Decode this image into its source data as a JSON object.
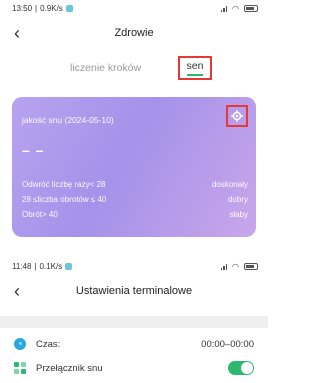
{
  "screen1": {
    "status": {
      "time": "13:50",
      "speed": "0.9K/s"
    },
    "title": "Zdrowie",
    "tabs": {
      "steps": "liczenie kroków",
      "sleep": "sen"
    },
    "card": {
      "quality_label": "jakość snu (2024-05-10)",
      "value": "– –",
      "rows": [
        {
          "condition": "Odwróć liczbę razy< 28",
          "rating": "doskonały"
        },
        {
          "condition": "28 ≤liczba obrotów ≤ 40",
          "rating": "dobry"
        },
        {
          "condition": "Obrót> 40",
          "rating": "słaby"
        }
      ]
    }
  },
  "screen2": {
    "status": {
      "time": "11:48",
      "speed": "0.1K/s"
    },
    "title": "Ustawienia terminalowe",
    "rows": [
      {
        "label": "Czas:",
        "value": "00:00–00:00"
      },
      {
        "label": "Przełącznik snu",
        "toggle_on": true
      }
    ]
  },
  "colors": {
    "accent_green": "#2eb872",
    "highlight_red": "#e53935",
    "card_purple": "#a592ea",
    "time_icon_blue": "#29a9e0"
  },
  "icons": {
    "back": "chevron-left-icon",
    "settings": "gear-icon",
    "time": "clock-icon",
    "sleep_switch": "sleep-switch-icon"
  }
}
